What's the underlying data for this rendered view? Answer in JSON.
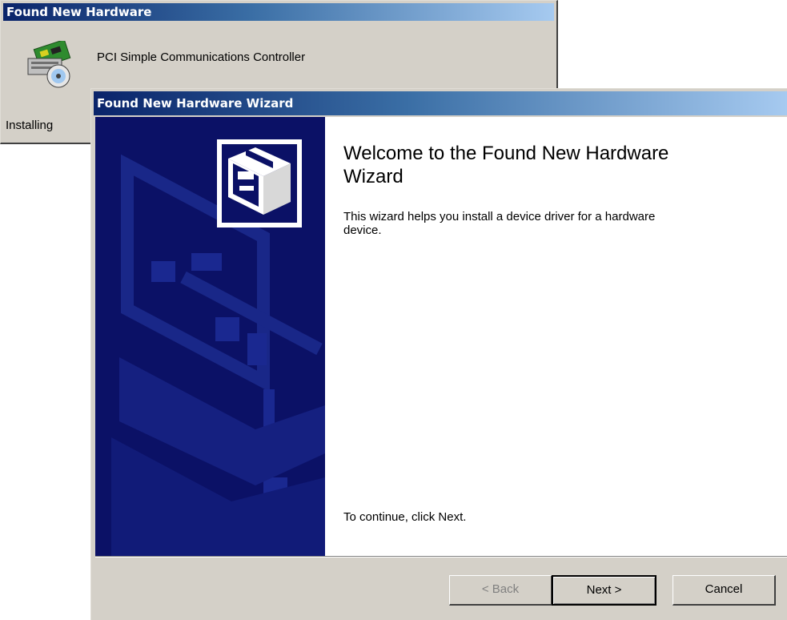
{
  "found_new_hardware": {
    "title": "Found New Hardware",
    "device_icon": "hardware-cd-icon",
    "device_name": "PCI Simple Communications Controller",
    "status": "Installing"
  },
  "wizard": {
    "title": "Found New Hardware Wizard",
    "banner_icon": "hardware-wizard-icon",
    "heading": "Welcome to the Found New Hardware Wizard",
    "description": "This wizard helps you install a device driver for a hardware device.",
    "continue_text": "To continue, click Next.",
    "buttons": {
      "back": "< Back",
      "next": "Next >",
      "cancel": "Cancel"
    },
    "colors": {
      "banner": "#0b1166",
      "title_bar": "#0a246a",
      "dialog_face": "#d4d0c8"
    }
  }
}
